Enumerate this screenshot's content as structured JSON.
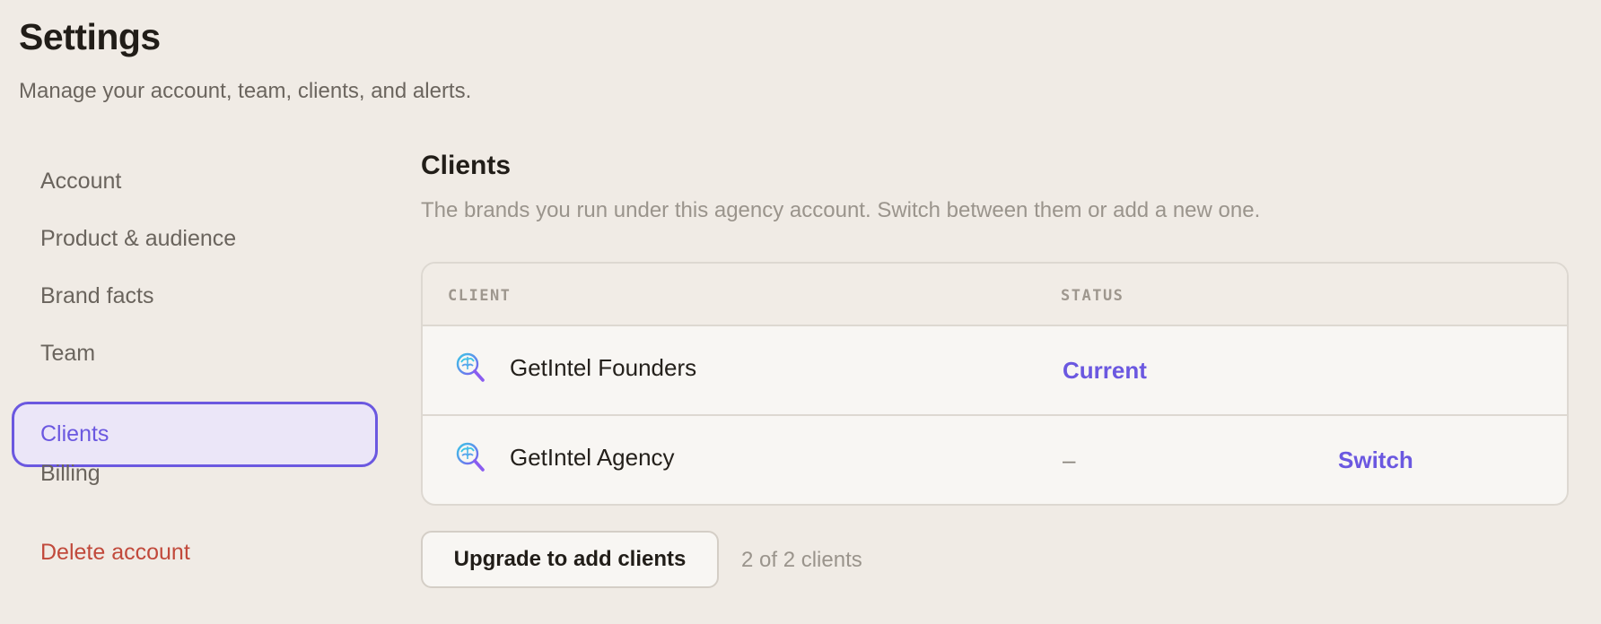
{
  "header": {
    "title": "Settings",
    "subtitle": "Manage your account, team, clients, and alerts."
  },
  "sidebar": {
    "items": [
      {
        "label": "Account"
      },
      {
        "label": "Product & audience"
      },
      {
        "label": "Brand facts"
      },
      {
        "label": "Team"
      },
      {
        "label": "Clients",
        "active": true
      },
      {
        "label": "Billing"
      }
    ],
    "delete_label": "Delete account"
  },
  "clients": {
    "title": "Clients",
    "description": "The brands you run under this agency account. Switch between them or add a new one.",
    "columns": {
      "client": "CLIENT",
      "status": "STATUS"
    },
    "rows": [
      {
        "name": "GetIntel Founders",
        "icon": "brain-search-icon",
        "status": "Current",
        "action": ""
      },
      {
        "name": "GetIntel Agency",
        "icon": "brain-search-icon",
        "status": "–",
        "action": "Switch"
      }
    ],
    "upgrade_label": "Upgrade to add clients",
    "count_text": "2 of 2 clients"
  },
  "colors": {
    "accent": "#6b58e0",
    "danger": "#c1493b",
    "background": "#f0ebe5"
  }
}
